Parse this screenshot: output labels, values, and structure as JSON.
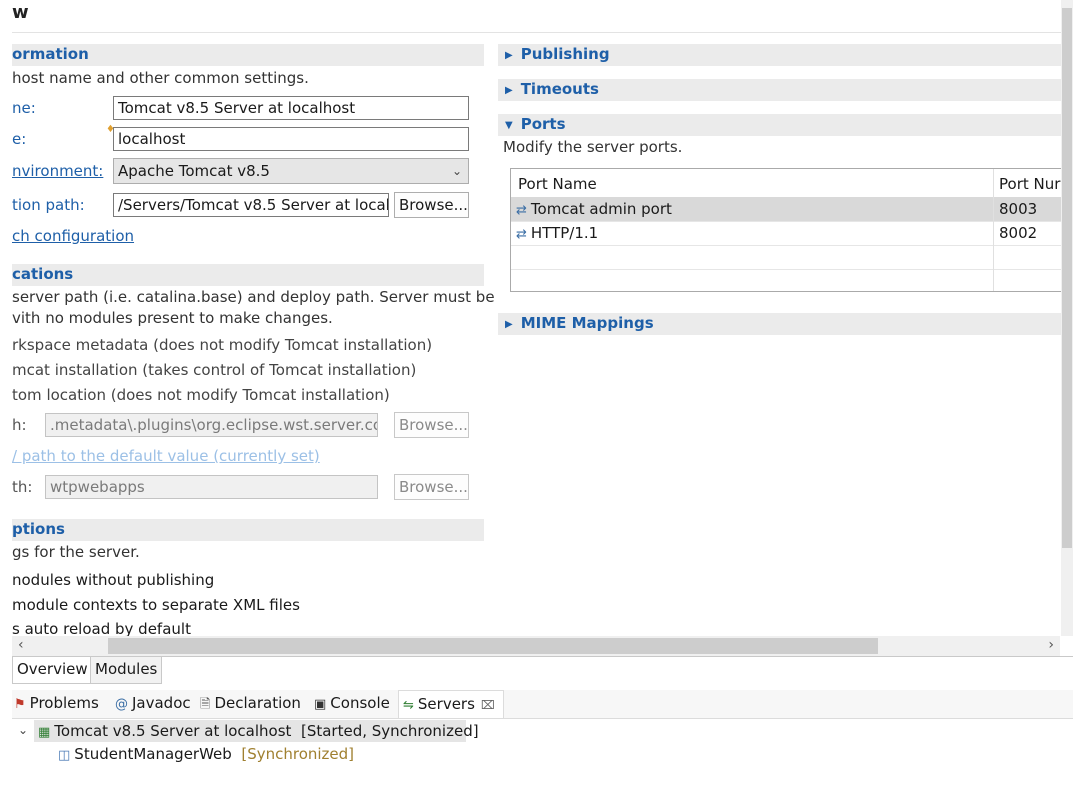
{
  "editor": {
    "title": "w",
    "general": {
      "section_title": "ormation",
      "description": "host name and other common settings.",
      "server_name_label": "ne:",
      "server_name_value": "Tomcat v8.5 Server at localhost",
      "host_name_label": "e:",
      "host_name_value": "localhost",
      "runtime_label": "nvironment:",
      "runtime_value": "Apache Tomcat v8.5",
      "config_path_label": "tion path:",
      "config_path_value": "/Servers/Tomcat v8.5 Server at localh",
      "browse_label": "Browse...",
      "launch_link": "ch configuration"
    },
    "locations": {
      "section_title": "cations",
      "description_line1": "server path (i.e. catalina.base) and deploy path. Server must be",
      "description_line2": "vith no modules present to make changes.",
      "option1": "rkspace metadata (does not modify Tomcat installation)",
      "option2": "mcat installation (takes control of Tomcat installation)",
      "option3": "tom location (does not modify Tomcat installation)",
      "server_path_label": "h:",
      "server_path_value": ".metadata\\.plugins\\org.eclipse.wst.server.co",
      "server_browse": "Browse...",
      "set_default_link": "/ path to the default value (currently set)",
      "deploy_path_label": "th:",
      "deploy_path_value": "wtpwebapps",
      "deploy_browse": "Browse..."
    },
    "options": {
      "section_title": "ptions",
      "description": "gs for the server.",
      "option1": "nodules without publishing",
      "option2": "module contexts to separate XML files",
      "option3": "s auto reload by default"
    },
    "right": {
      "publishing": "Publishing",
      "timeouts": "Timeouts",
      "ports": "Ports",
      "ports_description": "Modify the server ports.",
      "ports_columns": [
        "Port Name",
        "Port Nur"
      ],
      "ports_rows": [
        {
          "name": "Tomcat admin port",
          "value": "8003"
        },
        {
          "name": "HTTP/1.1",
          "value": "8002"
        }
      ],
      "mime": "MIME Mappings"
    },
    "tabs": [
      "Overview",
      "Modules"
    ]
  },
  "views": {
    "tabs": [
      "Problems",
      "Javadoc",
      "Declaration",
      "Console",
      "Servers"
    ],
    "server_node": "Tomcat v8.5 Server at localhost",
    "server_status": "[Started, Synchronized]",
    "module_node": "StudentManagerWeb",
    "module_status": "[Synchronized]"
  }
}
